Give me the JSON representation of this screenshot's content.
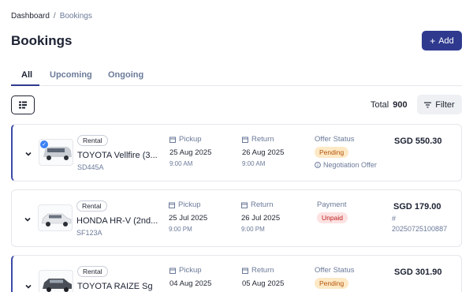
{
  "breadcrumb": {
    "home": "Dashboard",
    "separator": "/",
    "current": "Bookings"
  },
  "page_title": "Bookings",
  "add_button": {
    "icon": "plus-icon",
    "label": "Add"
  },
  "tabs": [
    {
      "label": "All",
      "active": true
    },
    {
      "label": "Upcoming",
      "active": false
    },
    {
      "label": "Ongoing",
      "active": false
    }
  ],
  "toolbar": {
    "total_label": "Total",
    "total_value": "900",
    "filter_label": "Filter"
  },
  "labels": {
    "pickup": "Pickup",
    "return": "Return"
  },
  "bookings": [
    {
      "tag": "Rental",
      "car_name": "TOYOTA Vellfire (3...",
      "car_code": "SD445A",
      "pickup_date": "25 Aug 2025",
      "pickup_time": "9:00 AM",
      "return_date": "26 Aug 2025",
      "return_time": "9:00 AM",
      "status_label": "Offer Status",
      "status": "Pending",
      "note": "Negotiation Offer",
      "price": "SGD 550.30"
    },
    {
      "tag": "Rental",
      "car_name": "HONDA HR-V (2nd...",
      "car_code": "SF123A",
      "pickup_date": "25 Jul 2025",
      "pickup_time": "9:00 PM",
      "return_date": "26 Jul 2025",
      "return_time": "9:00 PM",
      "status_label": "Payment",
      "status": "Unpaid",
      "price": "SGD 179.00",
      "hash": "#",
      "reference": "20250725100887"
    },
    {
      "tag": "Rental",
      "car_name": "TOYOTA RAIZE Sg",
      "pickup_date": "04 Aug 2025",
      "return_date": "05 Aug 2025",
      "status_label": "Offer Status",
      "status": "Pending",
      "price": "SGD 301.90"
    }
  ],
  "colors": {
    "accent": "#2f3a8f",
    "pending_bg": "#fde9c6",
    "pending_text": "#b45309",
    "unpaid_bg": "#fde2e2",
    "unpaid_text": "#b91c1c"
  }
}
